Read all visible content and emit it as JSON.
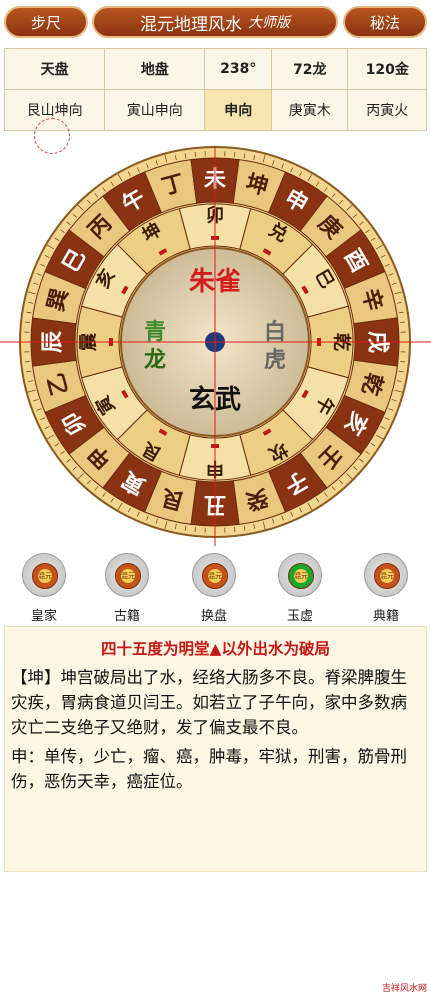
{
  "header": {
    "left_btn": "步尺",
    "title": "混元地理风水",
    "subtitle": "大师版",
    "right_btn": "秘法"
  },
  "table": {
    "row1": [
      "天盘",
      "地盘",
      "238°",
      "72龙",
      "120金"
    ],
    "row2": [
      "艮山坤向",
      "寅山申向",
      "申向",
      "庚寅木",
      "丙寅火"
    ]
  },
  "compass": {
    "outer_ring": [
      "申",
      "庚",
      "酉",
      "辛",
      "戌",
      "乾",
      "亥",
      "壬",
      "子",
      "癸",
      "丑",
      "艮",
      "寅",
      "甲",
      "卯",
      "乙",
      "辰",
      "巽",
      "巳",
      "丙",
      "午",
      "丁",
      "未",
      "坤"
    ],
    "inner_ring": [
      "卯",
      "兑",
      "巳",
      "乾",
      "午",
      "坎",
      "申",
      "艮",
      "寅",
      "震",
      "亥",
      "坤"
    ],
    "animals": {
      "top": "朱雀",
      "bottom": "玄武",
      "left": "青龙",
      "right": "白虎"
    },
    "left_char": "酉",
    "right_char": "午",
    "colors": {
      "ring_brown": "#8a3312",
      "ring_tan": "#e9c77e",
      "gold": "#f0c64c",
      "red": "#d21c1c",
      "green": "#3c8a2c"
    }
  },
  "icons": [
    {
      "label": "皇家",
      "core": "混元"
    },
    {
      "label": "古籍",
      "core": "混元"
    },
    {
      "label": "换盘",
      "core": "混元"
    },
    {
      "label": "玉虚",
      "core": "混元"
    },
    {
      "label": "典籍",
      "core": "混元"
    }
  ],
  "panel": {
    "title": "四十五度为明堂▲以外出水为破局",
    "para1": "【坤】坤宫破局出了水，经络大肠多不良。脊梁脾腹生灾疾，胃病食道贝闫王。如若立了子午向，家中多数病灾亡二支绝子又绝财，发了偏支最不良。",
    "para2": "申：单传，少亡，瘤、癌，肿毒，牢狱，刑害，筋骨刑伤，恶伤天幸，癌症位。"
  },
  "watermark": "吉祥风水网"
}
